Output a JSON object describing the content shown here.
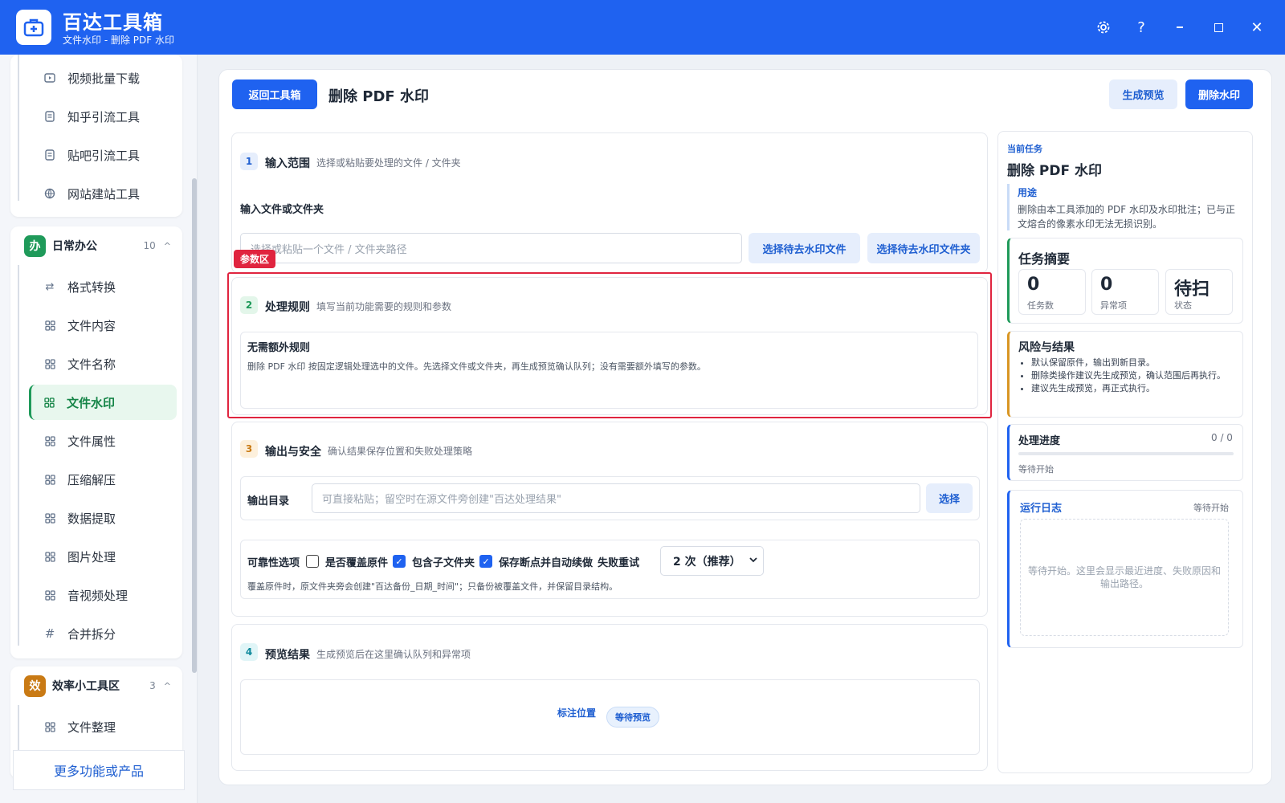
{
  "app": {
    "title": "百达工具箱",
    "subtitle": "文件水印 - 删除 PDF 水印"
  },
  "sidebar": {
    "top_items": [
      {
        "label": "视频批量下载",
        "icon": "play-icon"
      },
      {
        "label": "知乎引流工具",
        "icon": "doc-icon"
      },
      {
        "label": "贴吧引流工具",
        "icon": "doc-icon"
      },
      {
        "label": "网站建站工具",
        "icon": "globe-icon"
      }
    ],
    "group_daily": {
      "badge": "办",
      "name": "日常办公",
      "count": "10",
      "caret": "^"
    },
    "daily_items": [
      {
        "label": "格式转换",
        "icon": "swap-icon"
      },
      {
        "label": "文件内容",
        "icon": "grid-icon"
      },
      {
        "label": "文件名称",
        "icon": "grid-icon"
      },
      {
        "label": "文件水印",
        "icon": "grid-icon"
      },
      {
        "label": "文件属性",
        "icon": "grid-icon"
      },
      {
        "label": "压缩解压",
        "icon": "grid-icon"
      },
      {
        "label": "数据提取",
        "icon": "grid-icon"
      },
      {
        "label": "图片处理",
        "icon": "grid-icon"
      },
      {
        "label": "音视频处理",
        "icon": "grid-icon"
      },
      {
        "label": "合并拆分",
        "icon": "hash-icon"
      }
    ],
    "group_eff": {
      "badge": "效",
      "name": "效率小工具区",
      "count": "3",
      "caret": "^"
    },
    "eff_items": [
      {
        "label": "文件整理",
        "icon": "grid-icon"
      }
    ],
    "more": "更多功能或产品"
  },
  "toolbar": {
    "back": "返回工具箱",
    "title": "删除 PDF 水印",
    "preview": "生成预览",
    "run": "删除水印"
  },
  "sec1": {
    "num": "1",
    "title": "输入范围",
    "desc": "选择或粘贴要处理的文件 / 文件夹",
    "field_label": "输入文件或文件夹",
    "placeholder": "选择或粘贴一个文件 / 文件夹路径",
    "btn_file": "选择待去水印文件",
    "btn_folder": "选择待去水印文件夹"
  },
  "highlight_tag": "参数区",
  "sec2": {
    "num": "2",
    "title": "处理规则",
    "desc": "填写当前功能需要的规则和参数",
    "box_title": "无需额外规则",
    "box_text": "删除 PDF 水印 按固定逻辑处理选中的文件。先选择文件或文件夹，再生成预览确认队列；没有需要额外填写的参数。"
  },
  "sec3": {
    "num": "3",
    "title": "输出与安全",
    "desc": "确认结果保存位置和失败处理策略",
    "out_label": "输出目录",
    "out_placeholder": "可直接粘贴；留空时在源文件旁创建\"百达处理结果\"",
    "out_btn": "选择",
    "rel_label": "可靠性选项",
    "opt_overwrite": "是否覆盖原件",
    "opt_sub": "包含子文件夹",
    "opt_resume": "保存断点并自动续做",
    "retry_label": "失败重试",
    "retry_value": "2 次（推荐）",
    "note": "覆盖原件时，原文件夹旁会创建\"百达备份_日期_时间\"；只备份被覆盖文件，并保留目录结构。"
  },
  "sec4": {
    "num": "4",
    "title": "预览结果",
    "desc": "生成预览后在这里确认队列和异常项",
    "mark": "标注位置",
    "pill": "等待预览"
  },
  "right": {
    "kicker": "当前任务",
    "task": "删除 PDF 水印",
    "use_title": "用途",
    "use_text": "删除由本工具添加的 PDF 水印及水印批注；已与正文熔合的像素水印无法无损识别。",
    "summary_title": "任务摘要",
    "stats": [
      {
        "value": "0",
        "label": "任务数"
      },
      {
        "value": "0",
        "label": "异常项"
      },
      {
        "value": "待扫",
        "label": "状态"
      }
    ],
    "risk_title": "风险与结果",
    "risks": [
      "默认保留原件，输出到新目录。",
      "删除类操作建议先生成预览，确认范围后再执行。",
      "建议先生成预览，再正式执行。"
    ],
    "progress_title": "处理进度",
    "progress_count": "0 / 0",
    "progress_value": 0,
    "progress_status": "等待开始",
    "log_title": "运行日志",
    "log_status": "等待开始",
    "log_text": "等待开始。这里会显示最近进度、失败原因和输出路径。"
  },
  "colors": {
    "primary": "#1f62f0",
    "accent_green": "#1f9a5a",
    "highlight": "#e0243f"
  }
}
